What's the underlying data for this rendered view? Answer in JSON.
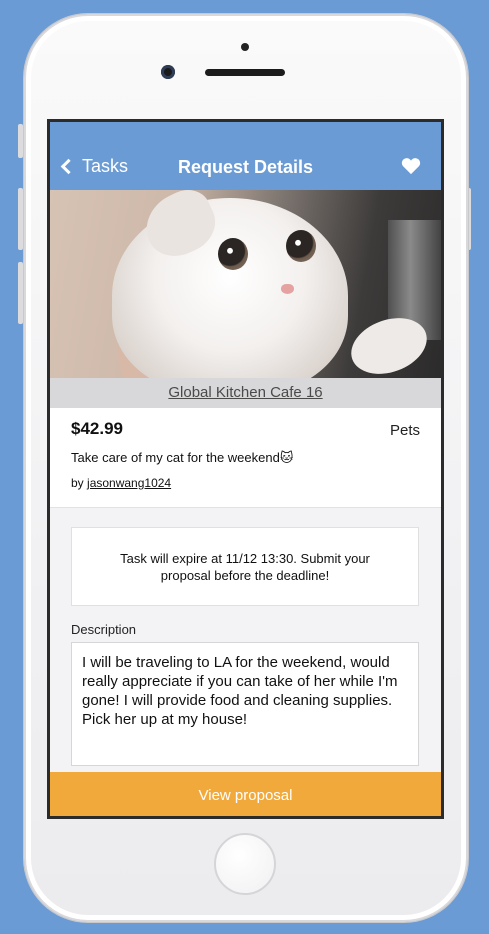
{
  "nav": {
    "back_label": "Tasks",
    "title": "Request Details",
    "favorite_icon": "heart-icon"
  },
  "hero": {
    "image_subject": "white cat"
  },
  "location": {
    "name": "Global Kitchen Cafe 16"
  },
  "task": {
    "price": "$42.99",
    "category": "Pets",
    "title": "Take care of my cat for the weekend🐱",
    "by_prefix": "by",
    "author": "jasonwang1024"
  },
  "notice": {
    "text": "Task will expire at 11/12 13:30. Submit your proposal before the deadline!"
  },
  "description": {
    "label": "Description",
    "text": "I will be traveling to LA for the weekend, would really appreciate if you can take of her while I'm gone! I will provide food and cleaning supplies. Pick her up at my house!"
  },
  "actions": {
    "view_proposal_label": "View proposal"
  },
  "colors": {
    "background": "#6a9bd4",
    "navbar": "#6a9bd4",
    "accent_button": "#f2a93b",
    "location_bar": "#d8d8da"
  }
}
